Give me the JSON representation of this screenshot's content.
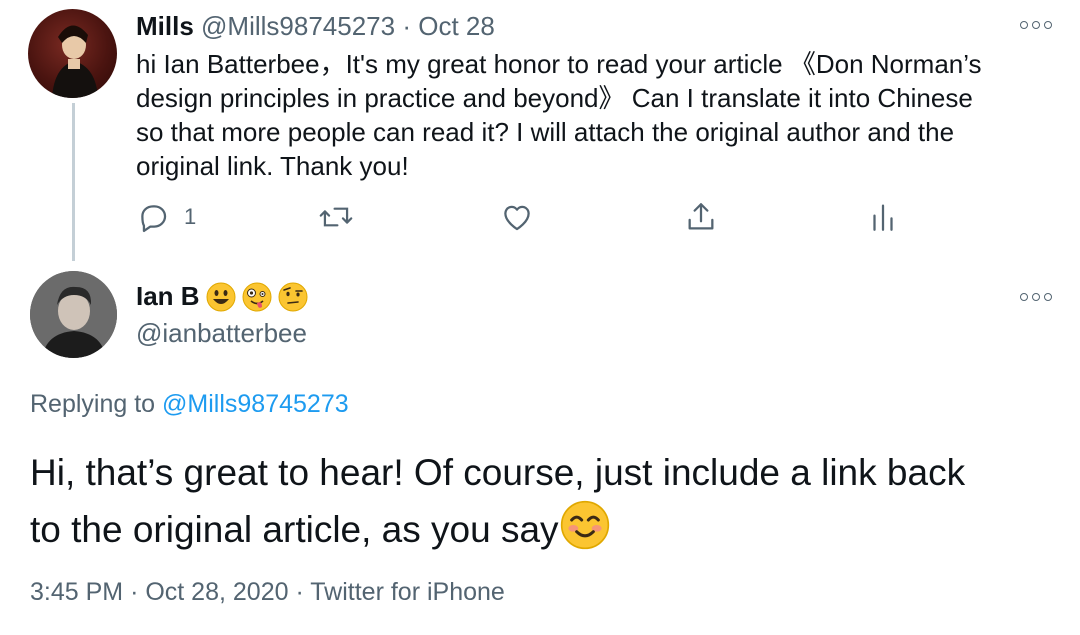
{
  "tweet1": {
    "name": "Mills",
    "handle": "@Mills98745273",
    "separator": "·",
    "date": "Oct 28",
    "text_lines": [
      "hi Ian Batterbee，It's my great honor to read your article 《Don Norman’s",
      "design principles in practice and beyond》 Can I translate it into Chinese",
      "so that more people can read it? I will attach the original author and the",
      "original link. Thank you!"
    ],
    "reply_count": "1",
    "icons": [
      "reply-icon",
      "retweet-icon",
      "like-icon",
      "share-icon",
      "analytics-icon",
      "more-icon"
    ]
  },
  "tweet2": {
    "name": "Ian B",
    "name_emojis": [
      "grinning-face-emoji",
      "zany-face-emoji",
      "face-with-raised-eyebrow-emoji"
    ],
    "handle": "@ianbatterbee",
    "replying_prefix": "Replying to",
    "replying_handle": "@Mills98745273",
    "text_lines": [
      "Hi, that’s great to hear! Of course, just include a link back",
      "to the original article, as you say"
    ],
    "text_emoji": "smiling-face-with-smiling-eyes-emoji",
    "time": "3:45 PM",
    "separator": "·",
    "date": "Oct 28, 2020",
    "separator2": "·",
    "source": "Twitter for iPhone"
  },
  "colors": {
    "text": "#0f1419",
    "secondary": "#536471",
    "link": "#1d9bf0",
    "thread_line": "#c4cfd6",
    "emoji_yellow": "#fbc531"
  }
}
